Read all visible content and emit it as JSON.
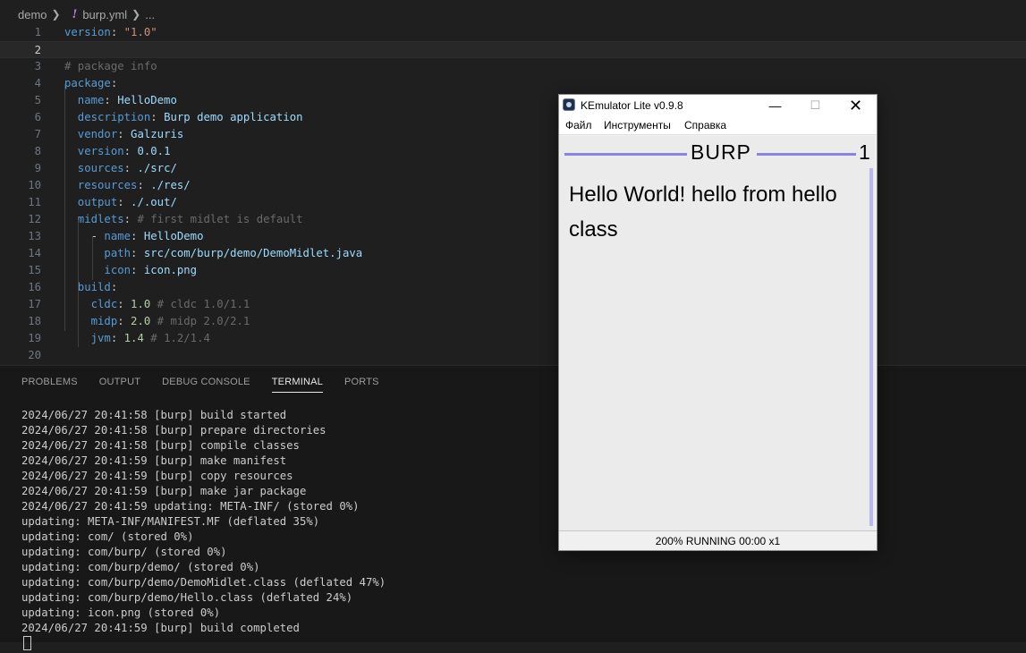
{
  "breadcrumb": {
    "folder": "demo",
    "file": "burp.yml",
    "more": "..."
  },
  "editor": {
    "line_numbers": [
      "1",
      "2",
      "3",
      "4",
      "5",
      "6",
      "7",
      "8",
      "9",
      "10",
      "11",
      "12",
      "13",
      "14",
      "15",
      "16",
      "17",
      "18",
      "19",
      "20"
    ],
    "lines": [
      [
        {
          "t": "version",
          "c": "k"
        },
        {
          "t": ": ",
          "c": "p"
        },
        {
          "t": "\"1.0\"",
          "c": "s"
        }
      ],
      [],
      [
        {
          "t": "# package info",
          "c": "c"
        }
      ],
      [
        {
          "t": "package",
          "c": "k"
        },
        {
          "t": ":",
          "c": "p"
        }
      ],
      [
        {
          "t": "  name",
          "c": "k"
        },
        {
          "t": ": ",
          "c": "p"
        },
        {
          "t": "HelloDemo",
          "c": "v"
        }
      ],
      [
        {
          "t": "  description",
          "c": "k"
        },
        {
          "t": ": ",
          "c": "p"
        },
        {
          "t": "Burp demo application",
          "c": "v"
        }
      ],
      [
        {
          "t": "  vendor",
          "c": "k"
        },
        {
          "t": ": ",
          "c": "p"
        },
        {
          "t": "Galzuris",
          "c": "v"
        }
      ],
      [
        {
          "t": "  version",
          "c": "k"
        },
        {
          "t": ": ",
          "c": "p"
        },
        {
          "t": "0.0.1",
          "c": "v"
        }
      ],
      [
        {
          "t": "  sources",
          "c": "k"
        },
        {
          "t": ": ",
          "c": "p"
        },
        {
          "t": "./src/",
          "c": "v"
        }
      ],
      [
        {
          "t": "  resources",
          "c": "k"
        },
        {
          "t": ": ",
          "c": "p"
        },
        {
          "t": "./res/",
          "c": "v"
        }
      ],
      [
        {
          "t": "  output",
          "c": "k"
        },
        {
          "t": ": ",
          "c": "p"
        },
        {
          "t": "./.out/",
          "c": "v"
        }
      ],
      [
        {
          "t": "  midlets",
          "c": "k"
        },
        {
          "t": ": ",
          "c": "p"
        },
        {
          "t": "# first midlet is default",
          "c": "c"
        }
      ],
      [
        {
          "t": "    - ",
          "c": "p"
        },
        {
          "t": "name",
          "c": "k"
        },
        {
          "t": ": ",
          "c": "p"
        },
        {
          "t": "HelloDemo",
          "c": "v"
        }
      ],
      [
        {
          "t": "      path",
          "c": "k"
        },
        {
          "t": ": ",
          "c": "p"
        },
        {
          "t": "src/com/burp/demo/DemoMidlet.java",
          "c": "v"
        }
      ],
      [
        {
          "t": "      icon",
          "c": "k"
        },
        {
          "t": ": ",
          "c": "p"
        },
        {
          "t": "icon.png",
          "c": "v"
        }
      ],
      [
        {
          "t": "  build",
          "c": "k"
        },
        {
          "t": ":",
          "c": "p"
        }
      ],
      [
        {
          "t": "    cldc",
          "c": "k"
        },
        {
          "t": ": ",
          "c": "p"
        },
        {
          "t": "1.0",
          "c": "n"
        },
        {
          "t": " # cldc 1.0/1.1",
          "c": "c"
        }
      ],
      [
        {
          "t": "    midp",
          "c": "k"
        },
        {
          "t": ": ",
          "c": "p"
        },
        {
          "t": "2.0",
          "c": "n"
        },
        {
          "t": " # midp 2.0/2.1",
          "c": "c"
        }
      ],
      [
        {
          "t": "    jvm",
          "c": "k"
        },
        {
          "t": ": ",
          "c": "p"
        },
        {
          "t": "1.4",
          "c": "n"
        },
        {
          "t": " # 1.2/1.4",
          "c": "c"
        }
      ],
      []
    ]
  },
  "panel": {
    "tabs": [
      "PROBLEMS",
      "OUTPUT",
      "DEBUG CONSOLE",
      "TERMINAL",
      "PORTS"
    ],
    "active_tab": "TERMINAL",
    "terminal_lines": [
      "2024/06/27 20:41:58 [burp] build started",
      "2024/06/27 20:41:58 [burp] prepare directories",
      "2024/06/27 20:41:58 [burp] compile classes",
      "2024/06/27 20:41:59 [burp] make manifest",
      "2024/06/27 20:41:59 [burp] copy resources",
      "2024/06/27 20:41:59 [burp] make jar package",
      "2024/06/27 20:41:59 updating: META-INF/ (stored 0%)",
      "updating: META-INF/MANIFEST.MF (deflated 35%)",
      "updating: com/ (stored 0%)",
      "updating: com/burp/ (stored 0%)",
      "updating: com/burp/demo/ (stored 0%)",
      "updating: com/burp/demo/DemoMidlet.class (deflated 47%)",
      "updating: com/burp/demo/Hello.class (deflated 24%)",
      "updating: icon.png (stored 0%)",
      "2024/06/27 20:41:59 [burp] build completed"
    ]
  },
  "emulator": {
    "title": "KEmulator Lite v0.9.8",
    "menu": [
      "Файл",
      "Инструменты",
      "Справка"
    ],
    "screen_title": "BURP",
    "screen_number": "1",
    "screen_text": "Hello World! hello from hello class",
    "status": "200%  RUNNING  00:00  x1"
  },
  "colors": {
    "editor_bg": "#1f1f1f",
    "key": "#569cd6",
    "value": "#9cdcfe",
    "string": "#ce9178",
    "comment": "#6a6a6a",
    "accent_line": "#8a84e0"
  }
}
